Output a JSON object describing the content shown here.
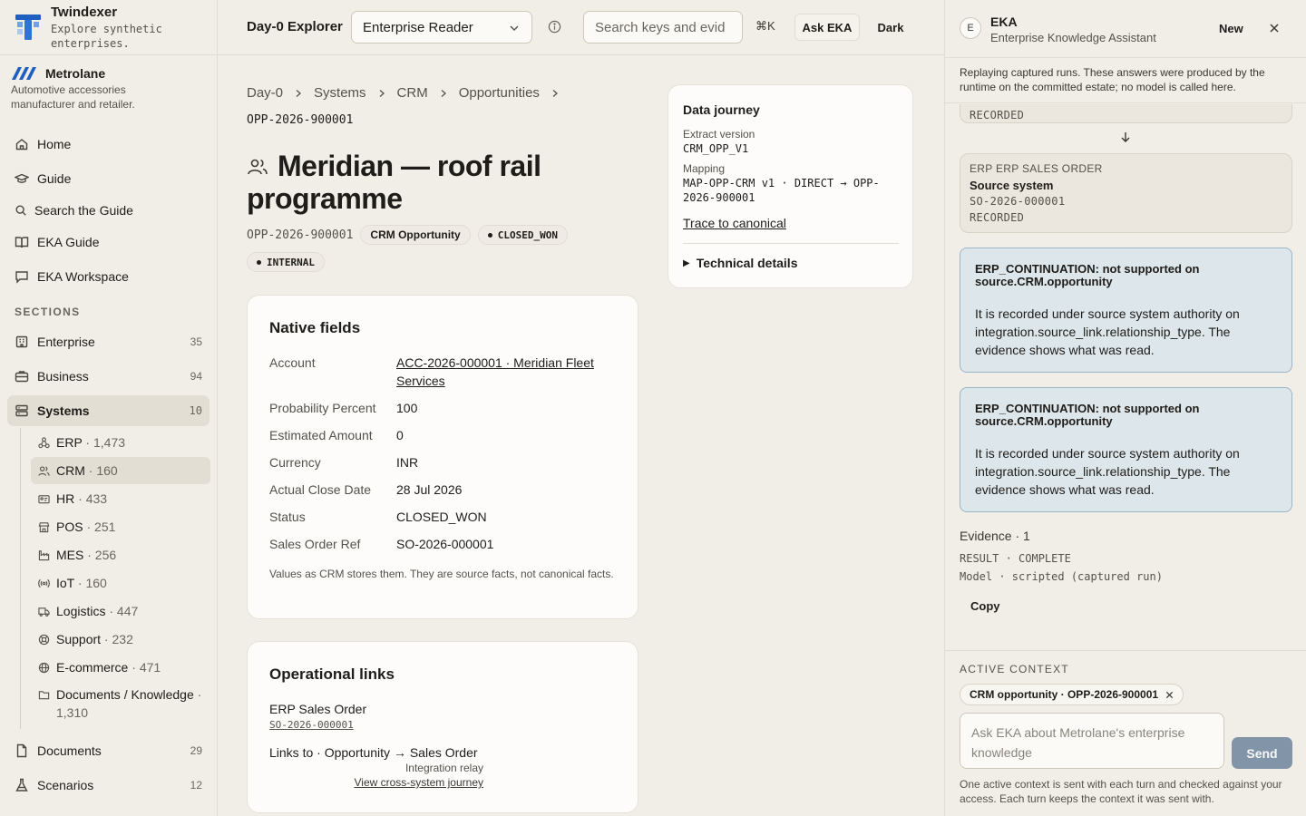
{
  "app": {
    "name": "Twindexer",
    "tagline": "Explore synthetic enterprises."
  },
  "org": {
    "name": "Metrolane",
    "description": "Automotive accessories manufacturer and retailer."
  },
  "nav": {
    "home": "Home",
    "guide": "Guide",
    "search_guide": "Search the Guide",
    "eka_guide": "EKA Guide",
    "eka_workspace": "EKA Workspace",
    "sections_label": "SECTIONS",
    "enterprise": {
      "label": "Enterprise",
      "count": "35"
    },
    "business": {
      "label": "Business",
      "count": "94"
    },
    "systems": {
      "label": "Systems",
      "count": "10"
    },
    "documents": {
      "label": "Documents",
      "count": "29"
    },
    "scenarios": {
      "label": "Scenarios",
      "count": "12"
    },
    "systems_items": [
      {
        "label": "ERP",
        "count": "1,473"
      },
      {
        "label": "CRM",
        "count": "160"
      },
      {
        "label": "HR",
        "count": "433"
      },
      {
        "label": "POS",
        "count": "251"
      },
      {
        "label": "MES",
        "count": "256"
      },
      {
        "label": "IoT",
        "count": "160"
      },
      {
        "label": "Logistics",
        "count": "447"
      },
      {
        "label": "Support",
        "count": "232"
      },
      {
        "label": "E-commerce",
        "count": "471"
      },
      {
        "label": "Documents / Knowledge",
        "count": "1,310"
      }
    ]
  },
  "topbar": {
    "title": "Day-0 Explorer",
    "role": "Enterprise Reader",
    "search_placeholder": "Search keys and evid",
    "shortcut": "⌘K",
    "ask_label": "Ask EKA",
    "theme_label": "Dark"
  },
  "breadcrumb": [
    "Day-0",
    "Systems",
    "CRM",
    "Opportunities"
  ],
  "record": {
    "id": "OPP-2026-900001",
    "title": "Meridian — roof rail programme",
    "type_chip": "CRM Opportunity",
    "status_chip": "CLOSED_WON",
    "visibility_chip": "INTERNAL"
  },
  "native_fields": {
    "heading": "Native fields",
    "rows": [
      {
        "label": "Account",
        "value": "ACC-2026-000001 · Meridian Fleet Services"
      },
      {
        "label": "Probability Percent",
        "value": "100"
      },
      {
        "label": "Estimated Amount",
        "value": "0"
      },
      {
        "label": "Currency",
        "value": "INR"
      },
      {
        "label": "Actual Close Date",
        "value": "28 Jul 2026"
      },
      {
        "label": "Status",
        "value": "CLOSED_WON"
      },
      {
        "label": "Sales Order Ref",
        "value": "SO-2026-000001"
      }
    ],
    "note": "Values as CRM stores them. They are source facts, not canonical facts."
  },
  "operational_links": {
    "heading": "Operational links",
    "link_title": "ERP Sales Order",
    "link_id": "SO-2026-000001",
    "relation": "Links to · Opportunity → Sales Order",
    "relation_sub": "Integration relay",
    "journey_link": "View cross-system journey"
  },
  "data_journey": {
    "heading": "Data journey",
    "extract_label": "Extract version",
    "extract_value": "CRM_OPP_V1",
    "mapping_label": "Mapping",
    "mapping_value": "MAP-OPP-CRM v1 · DIRECT → OPP-2026-900001",
    "trace_link": "Trace to canonical",
    "technical_label": "Technical details"
  },
  "eka": {
    "avatar": "E",
    "name": "EKA",
    "subtitle": "Enterprise Knowledge Assistant",
    "new_label": "New",
    "banner": "Replaying captured runs. These answers were produced by the runtime on the committed estate; no model is called here.",
    "prev_status": "RECORDED",
    "source_card": {
      "kind": "ERP ERP SALES ORDER",
      "title": "Source system",
      "id": "SO-2026-000001",
      "status": "RECORDED"
    },
    "notices": [
      {
        "title": "ERP_CONTINUATION: not supported on source.CRM.opportunity",
        "body": "It is recorded under source system authority on integration.source_link.relationship_type. The evidence shows what was read."
      },
      {
        "title": "ERP_CONTINUATION: not supported on source.CRM.opportunity",
        "body": "It is recorded under source system authority on integration.source_link.relationship_type. The evidence shows what was read."
      }
    ],
    "evidence_label": "Evidence · 1",
    "result_line": "RESULT · COMPLETE",
    "model_line": "Model · scripted (captured run)",
    "copy_label": "Copy",
    "context_label": "ACTIVE CONTEXT",
    "context_chip": "CRM opportunity · OPP-2026-900001",
    "ask_placeholder": "Ask EKA about Metrolane's enterprise knowledge",
    "send_label": "Send",
    "footer_note": "One active context is sent with each turn and checked against your access. Each turn keeps the context it was sent with."
  },
  "colors": {
    "accent_blue": "#1f5fbf",
    "notice_bg": "#dde6ea",
    "notice_border": "#9ab4c9",
    "send_bg": "#8295a8"
  }
}
